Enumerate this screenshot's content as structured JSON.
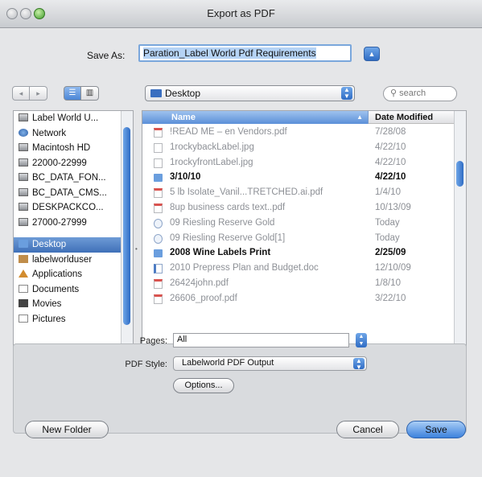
{
  "window": {
    "title": "Export as PDF"
  },
  "save_as": {
    "label": "Save As:",
    "value": "Paration_Label World Pdf Requirements"
  },
  "toolbar": {
    "back": "◂",
    "forward": "▸",
    "location": "Desktop",
    "search_placeholder": "search"
  },
  "sidebar": {
    "items": [
      {
        "label": "Label World U...",
        "icon": "drive-icon"
      },
      {
        "label": "Network",
        "icon": "network-icon"
      },
      {
        "label": "Macintosh HD",
        "icon": "drive-icon"
      },
      {
        "label": "22000-22999",
        "icon": "drive-icon"
      },
      {
        "label": "BC_DATA_FON...",
        "icon": "drive-icon"
      },
      {
        "label": "BC_DATA_CMS...",
        "icon": "drive-icon"
      },
      {
        "label": "DESKPACKCO...",
        "icon": "drive-icon"
      },
      {
        "label": "27000-27999",
        "icon": "drive-icon"
      },
      {
        "label": "Desktop",
        "icon": "folder-icon",
        "selected": true
      },
      {
        "label": "labelworlduser",
        "icon": "home-icon"
      },
      {
        "label": "Applications",
        "icon": "applications-icon"
      },
      {
        "label": "Documents",
        "icon": "documents-icon"
      },
      {
        "label": "Movies",
        "icon": "movies-icon"
      },
      {
        "label": "Pictures",
        "icon": "pictures-icon"
      }
    ]
  },
  "file_list": {
    "columns": {
      "name": "Name",
      "date": "Date Modified"
    },
    "rows": [
      {
        "name": "!READ ME – en Vendors.pdf",
        "date": "7/28/08",
        "type": "pdf"
      },
      {
        "name": "1rockybackLabel.jpg",
        "date": "4/22/10",
        "type": "img"
      },
      {
        "name": "1rockyfrontLabel.jpg",
        "date": "4/22/10",
        "type": "img"
      },
      {
        "name": "3/10/10",
        "date": "4/22/10",
        "type": "folder"
      },
      {
        "name": "5 lb Isolate_Vanil...TRETCHED.ai.pdf",
        "date": "1/4/10",
        "type": "pdf"
      },
      {
        "name": "8up business cards text..pdf",
        "date": "10/13/09",
        "type": "pdf"
      },
      {
        "name": "09 Riesling Reserve Gold",
        "date": "Today",
        "type": "gen"
      },
      {
        "name": "09 Riesling Reserve Gold[1]",
        "date": "Today",
        "type": "gen"
      },
      {
        "name": "2008 Wine Labels Print",
        "date": "2/25/09",
        "type": "folder"
      },
      {
        "name": "2010 Prepress Plan and Budget.doc",
        "date": "12/10/09",
        "type": "doc"
      },
      {
        "name": "26424john.pdf",
        "date": "1/8/10",
        "type": "pdf"
      },
      {
        "name": "26606_proof.pdf",
        "date": "3/22/10",
        "type": "pdf"
      }
    ]
  },
  "options": {
    "pages_label": "Pages:",
    "pages_value": "All",
    "pdf_style_label": "PDF Style:",
    "pdf_style_value": "Labelworld PDF Output",
    "options_button": "Options..."
  },
  "buttons": {
    "new_folder": "New Folder",
    "cancel": "Cancel",
    "save": "Save"
  },
  "colors": {
    "accent": "#3d82dd",
    "selection": "#4f7fc2"
  }
}
